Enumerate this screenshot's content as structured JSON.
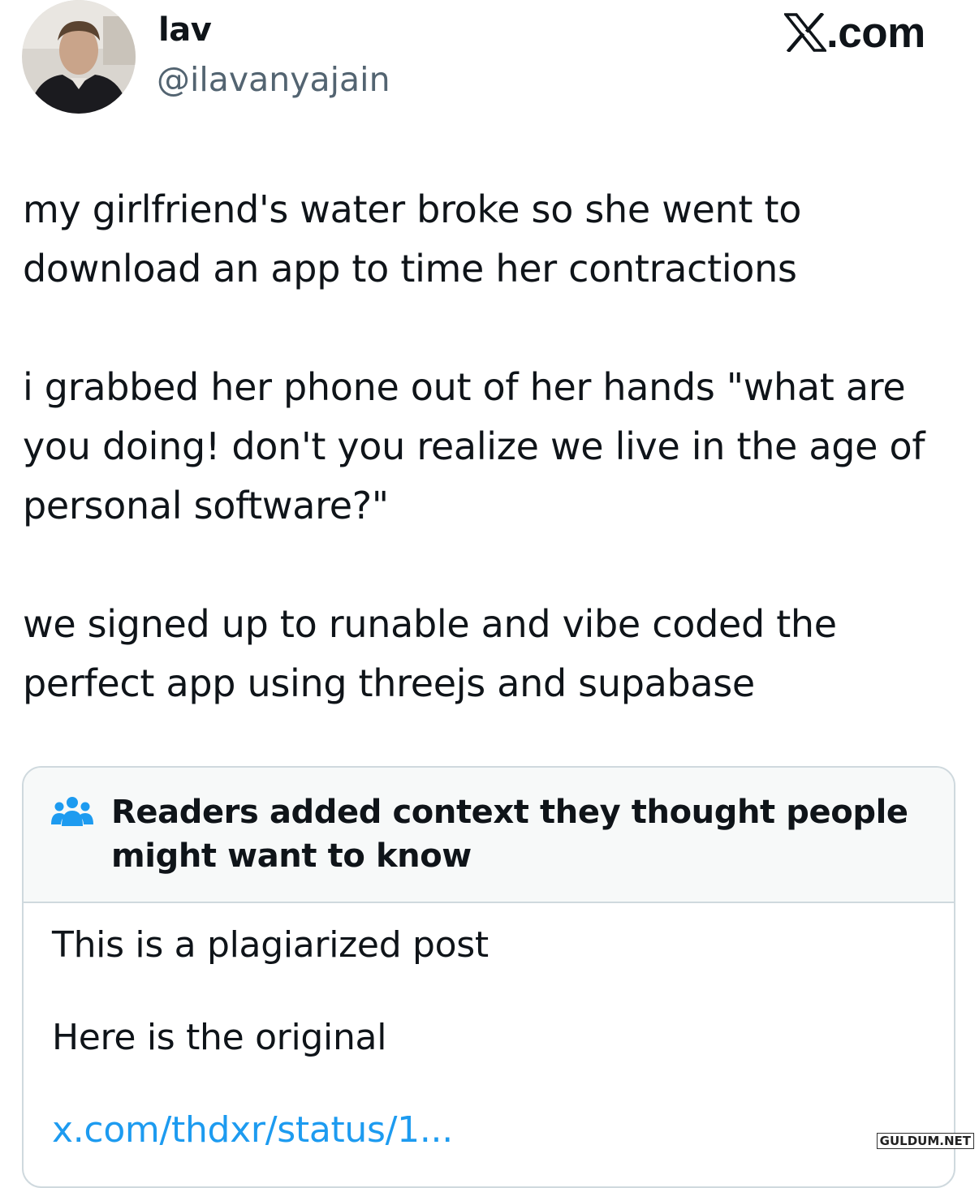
{
  "author": {
    "display_name": "lav",
    "handle": "@ilavanyajain"
  },
  "brand": {
    "text": ".com",
    "icon": "x-logo-icon"
  },
  "tweet": {
    "paragraphs": [
      "my girlfriend's water broke so she went to download an app to time her contractions",
      "i grabbed her phone out of her hands \"what are you doing! don't you realize we live in the age of personal software?\"",
      "we signed up to runable and vibe coded the perfect app using threejs and supabase"
    ]
  },
  "community_note": {
    "icon": "people-icon",
    "title": "Readers added context they thought people might want to know",
    "lines": [
      "This is a plagiarized post",
      "Here is the original"
    ],
    "link_text": "x.com/thdxr/status/1..."
  },
  "watermark": "GULDUM.NET",
  "colors": {
    "text": "#0f1419",
    "secondary": "#536471",
    "link": "#1d9bf0",
    "note_header_bg": "#f7f9f9",
    "border": "#cfd9de"
  }
}
